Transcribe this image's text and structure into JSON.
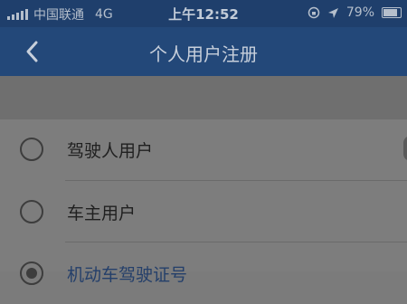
{
  "status_bar": {
    "carrier": "中国联通",
    "network": "4G",
    "time": "上午12:52",
    "battery": "79%"
  },
  "nav": {
    "title": "个人用户注册",
    "back_icon": "chevron-left-icon"
  },
  "options": [
    {
      "label": "驾驶人用户",
      "selected": false
    },
    {
      "label": "车主用户",
      "selected": false
    },
    {
      "label": "机动车驾驶证号",
      "selected": true
    }
  ],
  "colors": {
    "status_bar": "#1f3f6c",
    "nav_bar": "#234879",
    "background": "#7b7b7b"
  }
}
